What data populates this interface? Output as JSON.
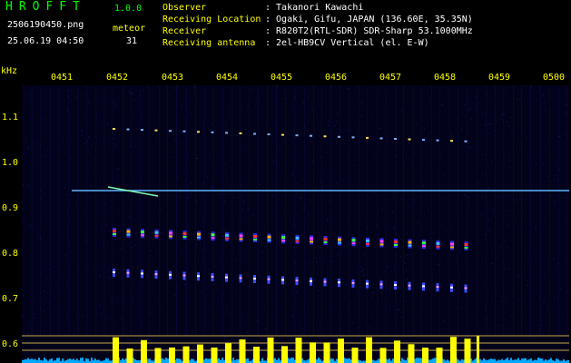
{
  "app": {
    "title": "HROFFT",
    "version": "1.0.0"
  },
  "file": {
    "name": "2506190450.png",
    "datetime": "25.06.19 04:50"
  },
  "meteor": {
    "label": "meteor",
    "count": "31"
  },
  "info": [
    {
      "key": "Observer",
      "value": ": Takanori Kawachi"
    },
    {
      "key": "Receiving Location",
      "value": ": Ogaki, Gifu, JAPAN (136.60E, 35.35N)"
    },
    {
      "key": "Receiver",
      "value": ": R820T2(RTL-SDR) SDR-Sharp 53.1000MHz"
    },
    {
      "key": "Receiving antenna",
      "value": ": 2el-HB9CV Vertical (el. E-W)"
    }
  ],
  "axis": {
    "unit": "kHz",
    "time_labels": [
      "0451",
      "0452",
      "0453",
      "0454",
      "0455",
      "0456",
      "0457",
      "0458",
      "0459",
      "0500"
    ],
    "freq_labels": [
      "1.1",
      "1.0",
      "0.9",
      "0.8",
      "0.7",
      "0.6"
    ]
  },
  "colors": {
    "text_yellow": "#ffff00",
    "text_green": "#00ff00",
    "text_white": "#ffffff",
    "background": "#000000",
    "carrier": "#5fb8ff",
    "bars": "#ffff00",
    "noise_floor": "#00a8ff"
  }
}
